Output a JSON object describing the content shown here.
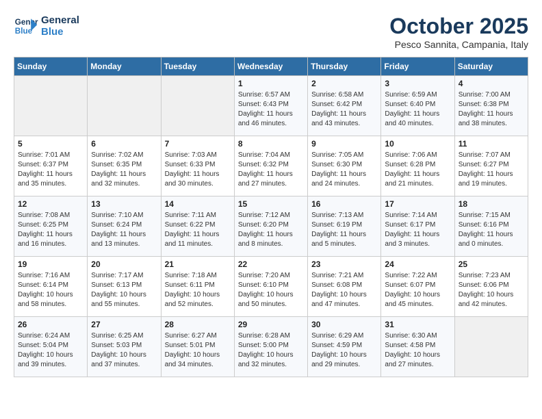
{
  "header": {
    "logo_line1": "General",
    "logo_line2": "Blue",
    "month": "October 2025",
    "location": "Pesco Sannita, Campania, Italy"
  },
  "days_of_week": [
    "Sunday",
    "Monday",
    "Tuesday",
    "Wednesday",
    "Thursday",
    "Friday",
    "Saturday"
  ],
  "weeks": [
    [
      {
        "day": "",
        "info": ""
      },
      {
        "day": "",
        "info": ""
      },
      {
        "day": "",
        "info": ""
      },
      {
        "day": "1",
        "info": "Sunrise: 6:57 AM\nSunset: 6:43 PM\nDaylight: 11 hours and 46 minutes."
      },
      {
        "day": "2",
        "info": "Sunrise: 6:58 AM\nSunset: 6:42 PM\nDaylight: 11 hours and 43 minutes."
      },
      {
        "day": "3",
        "info": "Sunrise: 6:59 AM\nSunset: 6:40 PM\nDaylight: 11 hours and 40 minutes."
      },
      {
        "day": "4",
        "info": "Sunrise: 7:00 AM\nSunset: 6:38 PM\nDaylight: 11 hours and 38 minutes."
      }
    ],
    [
      {
        "day": "5",
        "info": "Sunrise: 7:01 AM\nSunset: 6:37 PM\nDaylight: 11 hours and 35 minutes."
      },
      {
        "day": "6",
        "info": "Sunrise: 7:02 AM\nSunset: 6:35 PM\nDaylight: 11 hours and 32 minutes."
      },
      {
        "day": "7",
        "info": "Sunrise: 7:03 AM\nSunset: 6:33 PM\nDaylight: 11 hours and 30 minutes."
      },
      {
        "day": "8",
        "info": "Sunrise: 7:04 AM\nSunset: 6:32 PM\nDaylight: 11 hours and 27 minutes."
      },
      {
        "day": "9",
        "info": "Sunrise: 7:05 AM\nSunset: 6:30 PM\nDaylight: 11 hours and 24 minutes."
      },
      {
        "day": "10",
        "info": "Sunrise: 7:06 AM\nSunset: 6:28 PM\nDaylight: 11 hours and 21 minutes."
      },
      {
        "day": "11",
        "info": "Sunrise: 7:07 AM\nSunset: 6:27 PM\nDaylight: 11 hours and 19 minutes."
      }
    ],
    [
      {
        "day": "12",
        "info": "Sunrise: 7:08 AM\nSunset: 6:25 PM\nDaylight: 11 hours and 16 minutes."
      },
      {
        "day": "13",
        "info": "Sunrise: 7:10 AM\nSunset: 6:24 PM\nDaylight: 11 hours and 13 minutes."
      },
      {
        "day": "14",
        "info": "Sunrise: 7:11 AM\nSunset: 6:22 PM\nDaylight: 11 hours and 11 minutes."
      },
      {
        "day": "15",
        "info": "Sunrise: 7:12 AM\nSunset: 6:20 PM\nDaylight: 11 hours and 8 minutes."
      },
      {
        "day": "16",
        "info": "Sunrise: 7:13 AM\nSunset: 6:19 PM\nDaylight: 11 hours and 5 minutes."
      },
      {
        "day": "17",
        "info": "Sunrise: 7:14 AM\nSunset: 6:17 PM\nDaylight: 11 hours and 3 minutes."
      },
      {
        "day": "18",
        "info": "Sunrise: 7:15 AM\nSunset: 6:16 PM\nDaylight: 11 hours and 0 minutes."
      }
    ],
    [
      {
        "day": "19",
        "info": "Sunrise: 7:16 AM\nSunset: 6:14 PM\nDaylight: 10 hours and 58 minutes."
      },
      {
        "day": "20",
        "info": "Sunrise: 7:17 AM\nSunset: 6:13 PM\nDaylight: 10 hours and 55 minutes."
      },
      {
        "day": "21",
        "info": "Sunrise: 7:18 AM\nSunset: 6:11 PM\nDaylight: 10 hours and 52 minutes."
      },
      {
        "day": "22",
        "info": "Sunrise: 7:20 AM\nSunset: 6:10 PM\nDaylight: 10 hours and 50 minutes."
      },
      {
        "day": "23",
        "info": "Sunrise: 7:21 AM\nSunset: 6:08 PM\nDaylight: 10 hours and 47 minutes."
      },
      {
        "day": "24",
        "info": "Sunrise: 7:22 AM\nSunset: 6:07 PM\nDaylight: 10 hours and 45 minutes."
      },
      {
        "day": "25",
        "info": "Sunrise: 7:23 AM\nSunset: 6:06 PM\nDaylight: 10 hours and 42 minutes."
      }
    ],
    [
      {
        "day": "26",
        "info": "Sunrise: 6:24 AM\nSunset: 5:04 PM\nDaylight: 10 hours and 39 minutes."
      },
      {
        "day": "27",
        "info": "Sunrise: 6:25 AM\nSunset: 5:03 PM\nDaylight: 10 hours and 37 minutes."
      },
      {
        "day": "28",
        "info": "Sunrise: 6:27 AM\nSunset: 5:01 PM\nDaylight: 10 hours and 34 minutes."
      },
      {
        "day": "29",
        "info": "Sunrise: 6:28 AM\nSunset: 5:00 PM\nDaylight: 10 hours and 32 minutes."
      },
      {
        "day": "30",
        "info": "Sunrise: 6:29 AM\nSunset: 4:59 PM\nDaylight: 10 hours and 29 minutes."
      },
      {
        "day": "31",
        "info": "Sunrise: 6:30 AM\nSunset: 4:58 PM\nDaylight: 10 hours and 27 minutes."
      },
      {
        "day": "",
        "info": ""
      }
    ]
  ]
}
